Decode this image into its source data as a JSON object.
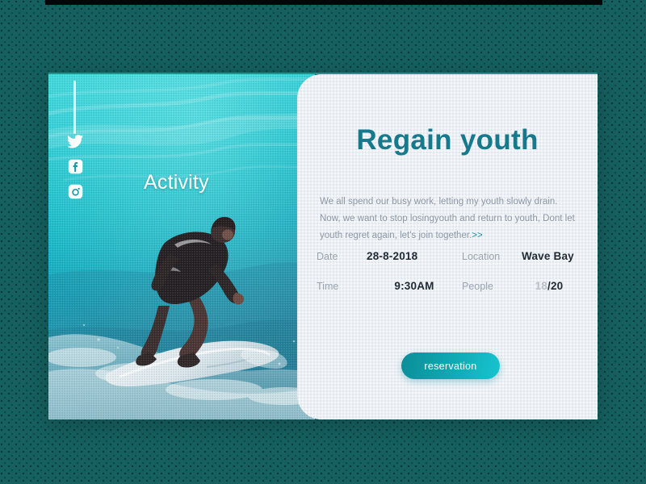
{
  "card": {
    "photo": {
      "alt_subject": "surfer riding a turquoise wave",
      "activity_label": "Activity",
      "social": [
        {
          "name": "twitter-icon",
          "label": "Twitter"
        },
        {
          "name": "facebook-icon",
          "label": "Facebook"
        },
        {
          "name": "instagram-icon",
          "label": "Instagram"
        }
      ]
    },
    "content": {
      "headline": "Regain youth",
      "description": "We all spend our busy work, letting my youth slowly drain. Now, we want to stop losingyouth and return to youth, Dont let  youth regret again, let's join together.",
      "description_arrows": ">>",
      "details": [
        {
          "label": "Date",
          "value": "28-8-2018"
        },
        {
          "label": "Location",
          "value": "Wave Bay"
        },
        {
          "label": "Time",
          "value": "9:30AM"
        },
        {
          "label": "People",
          "value": "18/20",
          "value_current": "18",
          "value_capacity": "/20"
        }
      ],
      "cta_label": "reservation"
    }
  },
  "colors": {
    "page_background": "#166060",
    "panel_background": "#edf1f5",
    "headline": "#16798c",
    "body_text": "#8d98a5",
    "detail_label": "#9aa4b0",
    "detail_value": "#1f2a33",
    "cta_gradient_start": "#0b8e98",
    "cta_gradient_end": "#17c4cf",
    "water_light": "#2fd2d8",
    "water_deep": "#1a6f8c"
  }
}
